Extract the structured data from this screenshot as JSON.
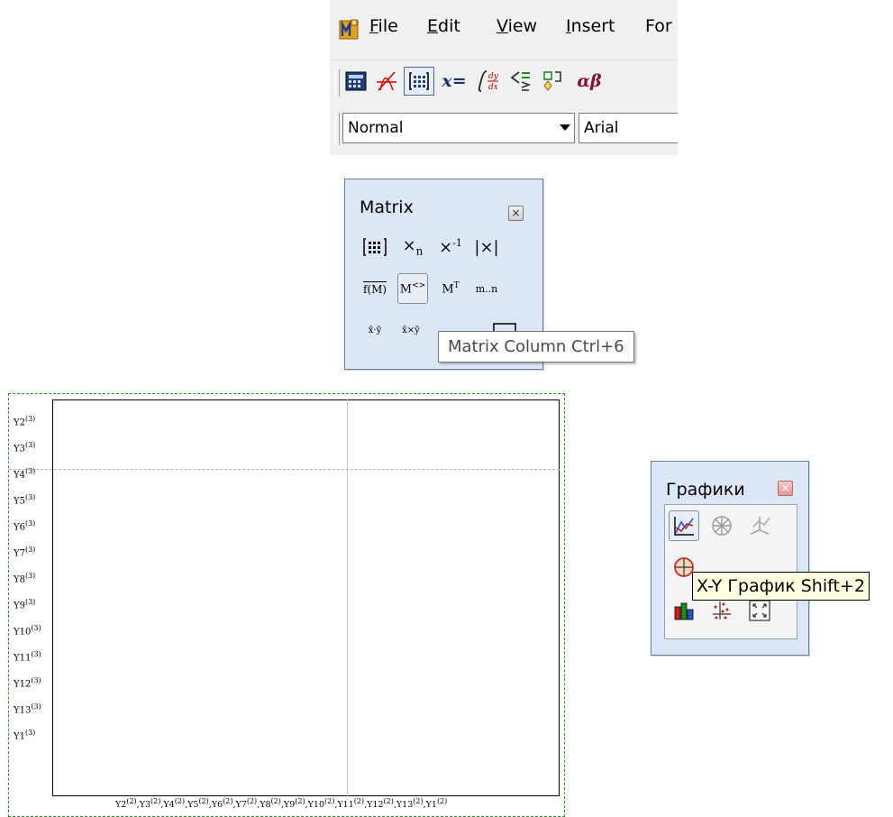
{
  "menubar": {
    "items": [
      {
        "label": "File",
        "accel": "F",
        "rest": "ile"
      },
      {
        "label": "Edit",
        "accel": "E",
        "rest": "dit"
      },
      {
        "label": "View",
        "accel": "V",
        "rest": "iew"
      },
      {
        "label": "Insert",
        "accel": "I",
        "rest": "nsert"
      },
      {
        "label": "For",
        "accel": "",
        "rest": "For"
      }
    ]
  },
  "toolbar": {
    "icons": [
      "calculator-icon",
      "graph-icon",
      "matrix-icon",
      "evaluation-icon",
      "calculus-icon",
      "boolean-icon",
      "programming-icon",
      "greek-icon"
    ],
    "eval_text": "x=",
    "greek_text": "αβ"
  },
  "format_bar": {
    "style_value": "Normal",
    "font_value": "Arial"
  },
  "matrix_palette": {
    "title": "Matrix",
    "close": "×",
    "buttons": [
      "[:::]",
      "Xn",
      "X-1",
      "|X|",
      "f(M)",
      "M<>",
      "MT",
      "m..n",
      "x·y",
      "x×y",
      "Σv",
      "[+]"
    ],
    "tooltip": "Matrix Column Ctrl+6"
  },
  "graph_palette": {
    "title": "Графики",
    "close": "×",
    "tooltip": "X-Y График Shift+2"
  },
  "plot": {
    "y_labels": [
      {
        "name": "Y2",
        "sup": "(3)"
      },
      {
        "name": "Y3",
        "sup": "(3)"
      },
      {
        "name": "Y4",
        "sup": "(3)"
      },
      {
        "name": "Y5",
        "sup": "(3)"
      },
      {
        "name": "Y6",
        "sup": "(3)"
      },
      {
        "name": "Y7",
        "sup": "(3)"
      },
      {
        "name": "Y8",
        "sup": "(3)"
      },
      {
        "name": "Y9",
        "sup": "(3)"
      },
      {
        "name": "Y10",
        "sup": "(3)"
      },
      {
        "name": "Y11",
        "sup": "(3)"
      },
      {
        "name": "Y12",
        "sup": "(3)"
      },
      {
        "name": "Y13",
        "sup": "(3)"
      },
      {
        "name": "Y1",
        "sup": "(3)"
      }
    ],
    "x_labels": [
      {
        "name": "Y2",
        "sup": "(2)"
      },
      {
        "name": "Y3",
        "sup": "(2)"
      },
      {
        "name": "Y4",
        "sup": "(2)"
      },
      {
        "name": "Y5",
        "sup": "(2)"
      },
      {
        "name": "Y6",
        "sup": "(2)"
      },
      {
        "name": "Y7",
        "sup": "(2)"
      },
      {
        "name": "Y8",
        "sup": "(2)"
      },
      {
        "name": "Y9",
        "sup": "(2)"
      },
      {
        "name": "Y10",
        "sup": "(2)"
      },
      {
        "name": "Y11",
        "sup": "(2)"
      },
      {
        "name": "Y12",
        "sup": "(2)"
      },
      {
        "name": "Y13",
        "sup": "(2)"
      },
      {
        "name": "Y1",
        "sup": "(2)"
      }
    ]
  }
}
